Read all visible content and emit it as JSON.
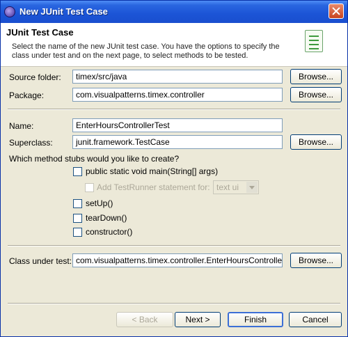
{
  "window": {
    "title": "New JUnit Test Case"
  },
  "banner": {
    "title": "JUnit Test Case",
    "description": "Select the name of the new JUnit test case. You have the options to specify the class under test and on the next page, to select methods to be tested."
  },
  "source_folder": {
    "label": "Source folder:",
    "value": "timex/src/java",
    "browse": "Browse..."
  },
  "package": {
    "label": "Package:",
    "value": "com.visualpatterns.timex.controller",
    "browse": "Browse..."
  },
  "name": {
    "label": "Name:",
    "value": "EnterHoursControllerTest"
  },
  "superclass": {
    "label": "Superclass:",
    "value": "junit.framework.TestCase",
    "browse": "Browse..."
  },
  "stubs": {
    "question": "Which method stubs would you like to create?",
    "main": "public static void main(String[] args)",
    "add_testrunner": "Add TestRunner statement for:",
    "testrunner_option": "text ui",
    "setup": "setUp()",
    "teardown": "tearDown()",
    "constructor": "constructor()"
  },
  "class_under_test": {
    "label": "Class under test:",
    "value": "com.visualpatterns.timex.controller.EnterHoursController",
    "browse": "Browse..."
  },
  "buttons": {
    "back": "< Back",
    "next": "Next >",
    "finish": "Finish",
    "cancel": "Cancel"
  }
}
